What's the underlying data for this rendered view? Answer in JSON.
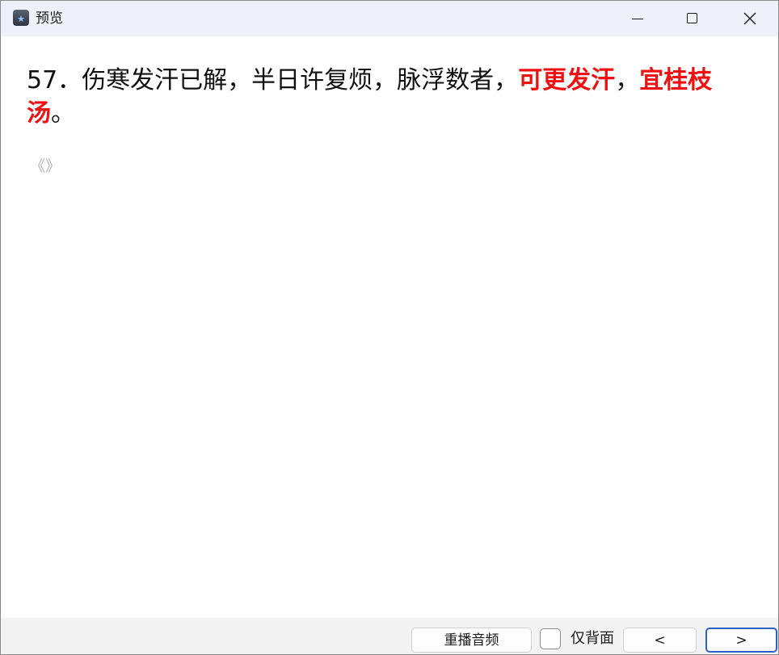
{
  "window": {
    "title": "预览",
    "minimize_icon": "minimize-icon",
    "maximize_icon": "maximize-icon",
    "close_icon": "close-icon"
  },
  "card": {
    "prefix": "57．伤寒发汗已解，半日许复烦，脉浮数者，",
    "answer1": "可更发汗",
    "sep": "，",
    "answer2": "宜桂枝汤",
    "suffix": "。",
    "source": "《》",
    "highlight_color": "#ee1111"
  },
  "footer": {
    "replay_label": "重播音频",
    "back_only_label": "仅背面",
    "back_only_checked": false,
    "prev_label": "<",
    "next_label": ">"
  }
}
